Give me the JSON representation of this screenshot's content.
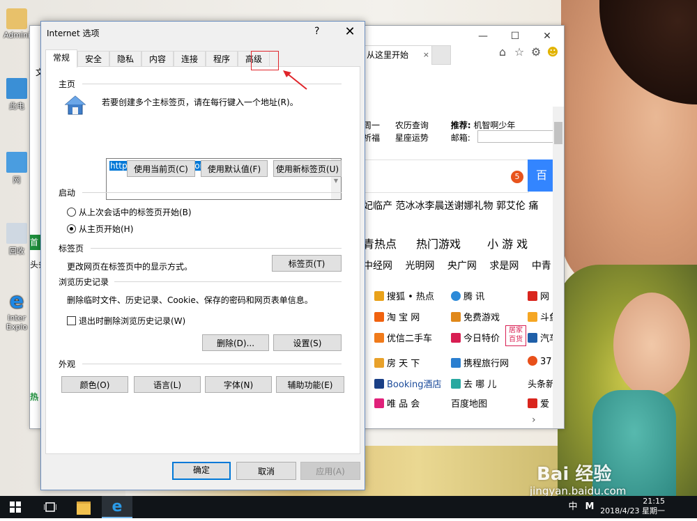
{
  "desktop": {
    "icons": [
      {
        "label": "Admini"
      },
      {
        "label": "此电"
      },
      {
        "label": "网"
      },
      {
        "label": "回收"
      },
      {
        "label": "Inter Explo"
      }
    ]
  },
  "ie_window": {
    "tab_title": "从这里开始",
    "tab_close": "×",
    "window_buttons": {
      "minimize": "—",
      "maximize": "☐",
      "close": "✕"
    },
    "toolbar_icons": [
      "home-icon",
      "star-icon",
      "gear-icon",
      "smiley-icon"
    ],
    "content": {
      "row1": {
        "a": "周一",
        "b": "农历查询",
        "c_label": "推荐:",
        "c_value": "机智啊少年"
      },
      "row2": {
        "a": "祈福",
        "b": "星座运势",
        "c_label": "邮箱:"
      },
      "search_badge": "5",
      "search_button": "百",
      "news_line": "妃临产    范冰冰李晨送谢娜礼物    郭艾伦 痛",
      "tab_a": "青热点",
      "tab_b": "热门游戏",
      "tab_c": "小 游 戏",
      "links_row": [
        "中经网",
        "光明网",
        "央广网",
        "求是网",
        "中青"
      ],
      "sites": [
        [
          "搜狐 • 热点",
          "腾  讯",
          "网"
        ],
        [
          "淘 宝 网",
          "免费游戏",
          "斗鱼"
        ],
        [
          "优信二手车",
          "今日特价",
          "汽车"
        ],
        [
          "房 天 下",
          "携程旅行网",
          "37"
        ],
        [
          "Booking酒店",
          "去 哪 儿",
          "头条新"
        ],
        [
          "唯 品 会",
          "百度地图",
          "爱"
        ]
      ],
      "badge_text": "居家\n百货"
    },
    "left_fragments": {
      "a": "文",
      "b": "首页",
      "c": "头条",
      "d": "热"
    }
  },
  "dialog": {
    "title": "Internet 选项",
    "help": "?",
    "close": "✕",
    "tabs": [
      "常规",
      "安全",
      "隐私",
      "内容",
      "连接",
      "程序",
      "高级"
    ],
    "home": {
      "section": "主页",
      "description": "若要创建多个主标签页，请在每行键入一个地址(R)。",
      "url": "http://www.me169.com/",
      "btn_current": "使用当前页(C)",
      "btn_default": "使用默认值(F)",
      "btn_newtab": "使用新标签页(U)"
    },
    "startup": {
      "section": "启动",
      "option1": "从上次会话中的标签页开始(B)",
      "option2": "从主页开始(H)",
      "selected": 2
    },
    "tabs_section": {
      "section": "标签页",
      "description": "更改网页在标签页中的显示方式。",
      "button": "标签页(T)"
    },
    "history": {
      "section": "浏览历史记录",
      "description": "删除临时文件、历史记录、Cookie、保存的密码和网页表单信息。",
      "checkbox": "退出时删除浏览历史记录(W)",
      "btn_delete": "删除(D)...",
      "btn_settings": "设置(S)"
    },
    "appearance": {
      "section": "外观",
      "btn_colors": "颜色(O)",
      "btn_languages": "语言(L)",
      "btn_fonts": "字体(N)",
      "btn_accessibility": "辅助功能(E)"
    },
    "footer": {
      "ok": "确定",
      "cancel": "取消",
      "apply": "应用(A)"
    }
  },
  "taskbar": {
    "ime": "中",
    "ime2": "M",
    "time": "21:15",
    "date": "2018/4/23 星期一"
  },
  "watermark": {
    "brand": "Bai   经验",
    "url": "jingyan.baidu.com"
  },
  "colors": {
    "accent": "#0078d7",
    "annotation": "#e0242a",
    "taskbar": "#101418"
  }
}
